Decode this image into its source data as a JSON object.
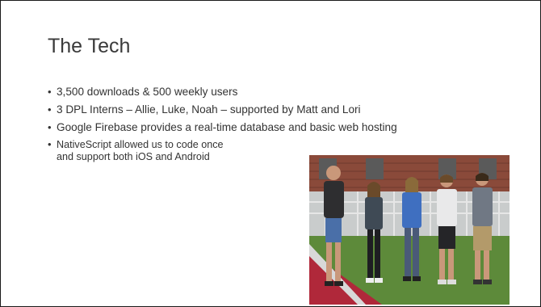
{
  "slide": {
    "title": "The Tech",
    "bullets": [
      "3,500 downloads & 500 weekly users",
      "3 DPL Interns – Allie, Luke, Noah – supported by Matt and Lori",
      "Google Firebase provides a real-time database and basic web hosting"
    ],
    "bullet_multiline": {
      "line1": "NativeScript allowed us to code once",
      "line2": "and support both iOS and Android"
    },
    "bullet_glyph": "•"
  }
}
